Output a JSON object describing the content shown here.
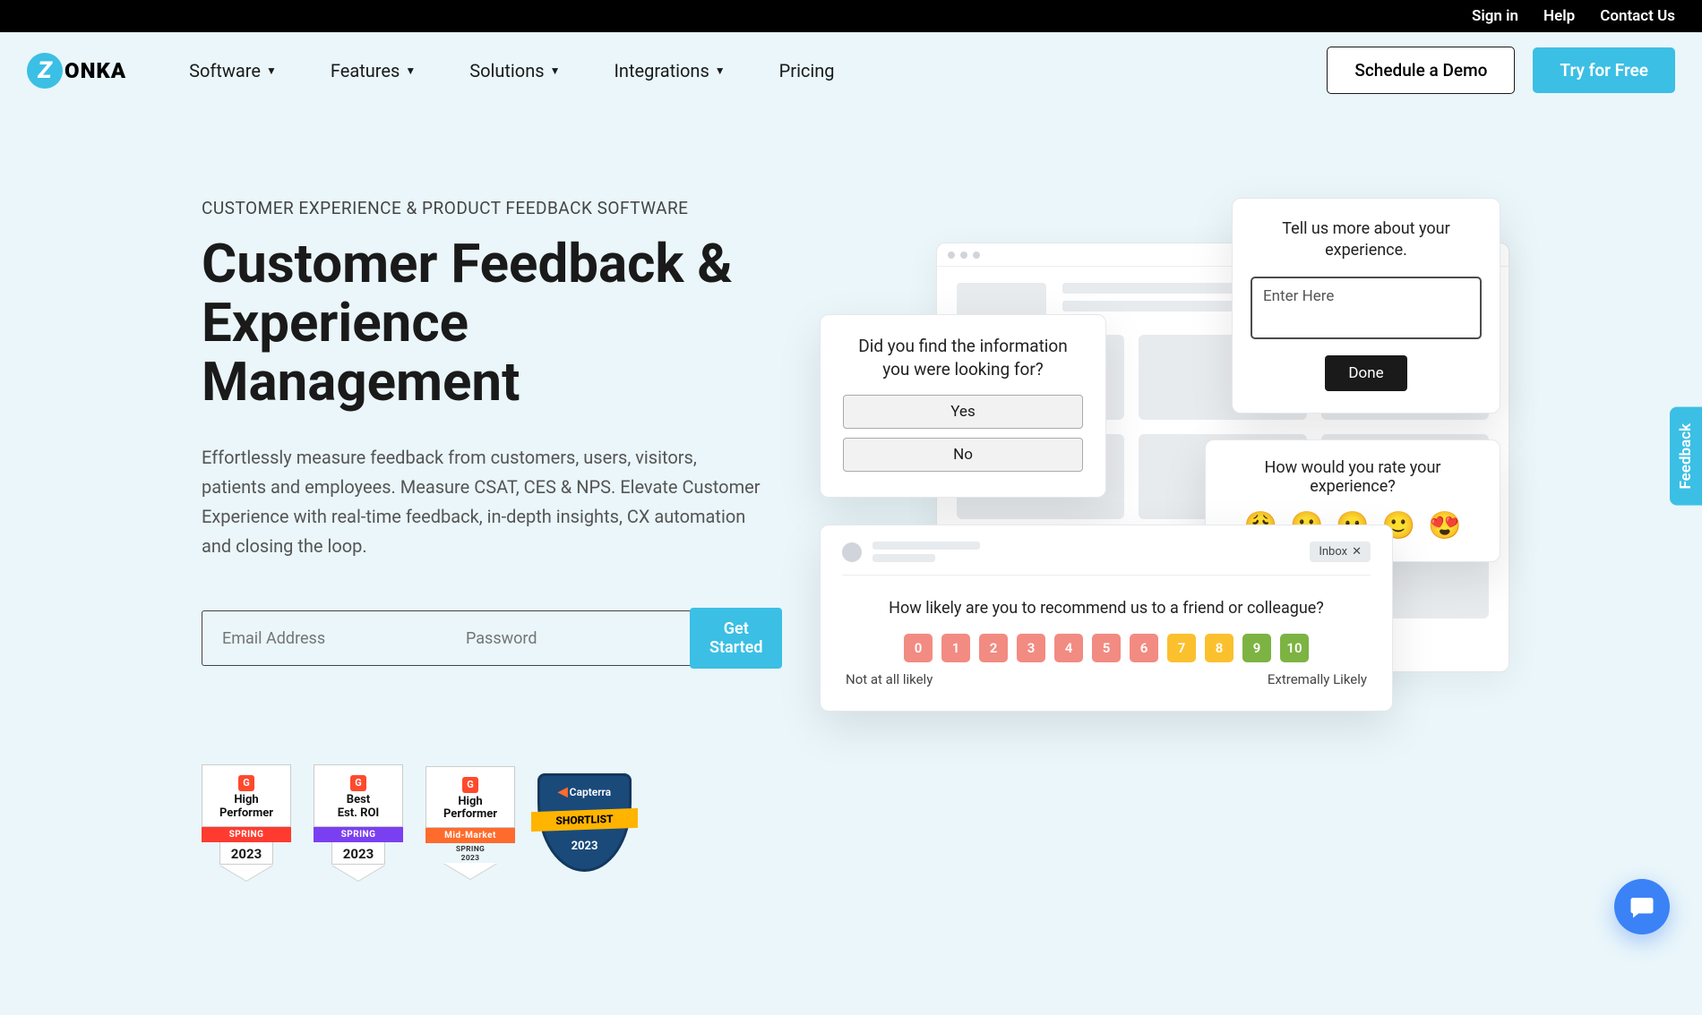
{
  "topbar": {
    "sign_in": "Sign in",
    "help": "Help",
    "contact": "Contact Us"
  },
  "logo": {
    "text": "ONKA",
    "initial": "Z"
  },
  "nav": {
    "software": "Software",
    "features": "Features",
    "solutions": "Solutions",
    "integrations": "Integrations",
    "pricing": "Pricing"
  },
  "header_buttons": {
    "demo": "Schedule a Demo",
    "try": "Try for Free"
  },
  "hero": {
    "overline": "CUSTOMER EXPERIENCE & PRODUCT FEEDBACK SOFTWARE",
    "title": "Customer Feedback & Experience Management",
    "description": "Effortlessly measure feedback from customers, users, visitors, patients and employees. Measure CSAT, CES & NPS. Elevate Customer Experience with real-time feedback, in-depth insights, CX automation and closing the loop.",
    "email_ph": "Email Address",
    "password_ph": "Password",
    "get_started": "Get Started"
  },
  "badges": [
    {
      "name": "High\nPerformer",
      "ribbon": "SPRING",
      "sub": "",
      "year": "2023",
      "color": "red"
    },
    {
      "name": "Best\nEst. ROI",
      "ribbon": "SPRING",
      "sub": "",
      "year": "2023",
      "color": "purple"
    },
    {
      "name": "High\nPerformer",
      "ribbon": "Mid-Market",
      "sub": "SPRING\n2023",
      "year": "",
      "color": "orange"
    }
  ],
  "capterra": {
    "brand": "Capterra",
    "ribbon": "SHORTLIST",
    "year": "2023"
  },
  "popup_yesno": {
    "q": "Did you find the information you were looking for?",
    "yes": "Yes",
    "no": "No"
  },
  "popup_text": {
    "q": "Tell us more about your experience.",
    "placeholder": "Enter Here",
    "done": "Done"
  },
  "popup_emoji": {
    "q": "How would you rate your experience?",
    "faces": [
      "😩",
      "😕",
      "😐",
      "🙂",
      "😍"
    ]
  },
  "popup_nps": {
    "inbox": "Inbox",
    "q": "How likely are you to recommend us to a friend or colleague?",
    "scale": [
      "0",
      "1",
      "2",
      "3",
      "4",
      "5",
      "6",
      "7",
      "8",
      "9",
      "10"
    ],
    "colors": [
      "#f28b82",
      "#f28b82",
      "#f28b82",
      "#f28b82",
      "#f28b82",
      "#f28b82",
      "#f28b82",
      "#fbc02d",
      "#fbc02d",
      "#7cb342",
      "#7cb342"
    ],
    "low": "Not at all likely",
    "high": "Extremally Likely"
  },
  "side_tab": "Feedback"
}
